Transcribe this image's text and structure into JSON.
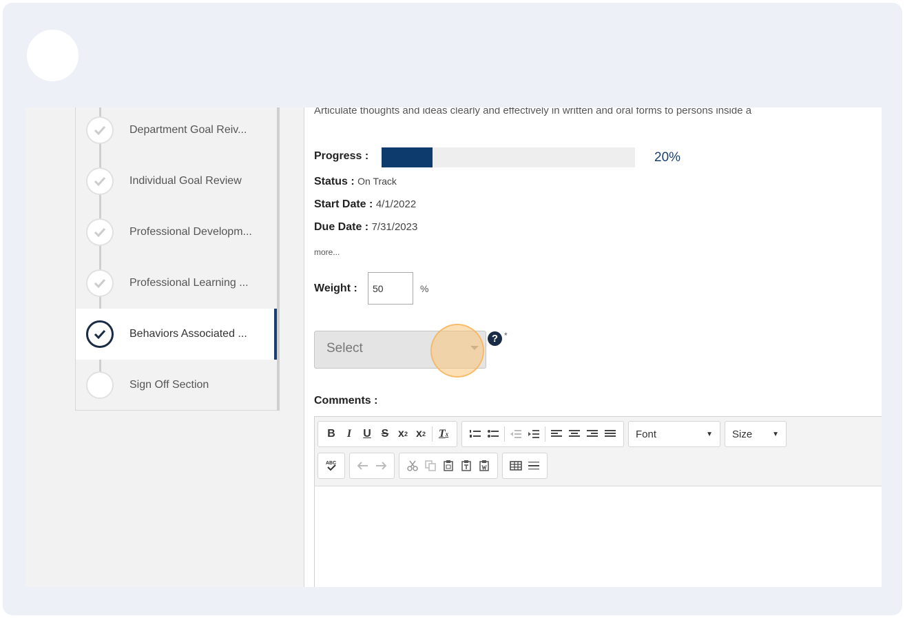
{
  "stepper": {
    "items": [
      {
        "label": "Department Goal Reiv...",
        "status": "complete"
      },
      {
        "label": "Individual Goal Review",
        "status": "complete"
      },
      {
        "label": "Professional Developm...",
        "status": "complete"
      },
      {
        "label": "Professional Learning ...",
        "status": "complete"
      },
      {
        "label": "Behaviors Associated ...",
        "status": "current"
      },
      {
        "label": "Sign Off Section",
        "status": "pending"
      }
    ]
  },
  "goal": {
    "description": "Articulate thoughts and ideas clearly and effectively in written and oral forms to persons inside a",
    "progress_label": "Progress :",
    "progress_value": 20,
    "progress_text": "20%",
    "status_label": "Status :",
    "status_value": "On Track",
    "start_label": "Start Date :",
    "start_value": "4/1/2022",
    "due_label": "Due Date :",
    "due_value": "7/31/2023",
    "more_link": "more...",
    "weight_label": "Weight :",
    "weight_value": "50",
    "weight_unit": "%"
  },
  "rating": {
    "placeholder": "Select",
    "help_glyph": "?",
    "required_mark": "*"
  },
  "comments": {
    "label": "Comments :",
    "toolbar": {
      "font_label": "Font",
      "size_label": "Size"
    }
  },
  "colors": {
    "accent": "#0d3b6e",
    "active_marker": "#1c3f6e",
    "click_halo": "#fcc478"
  }
}
